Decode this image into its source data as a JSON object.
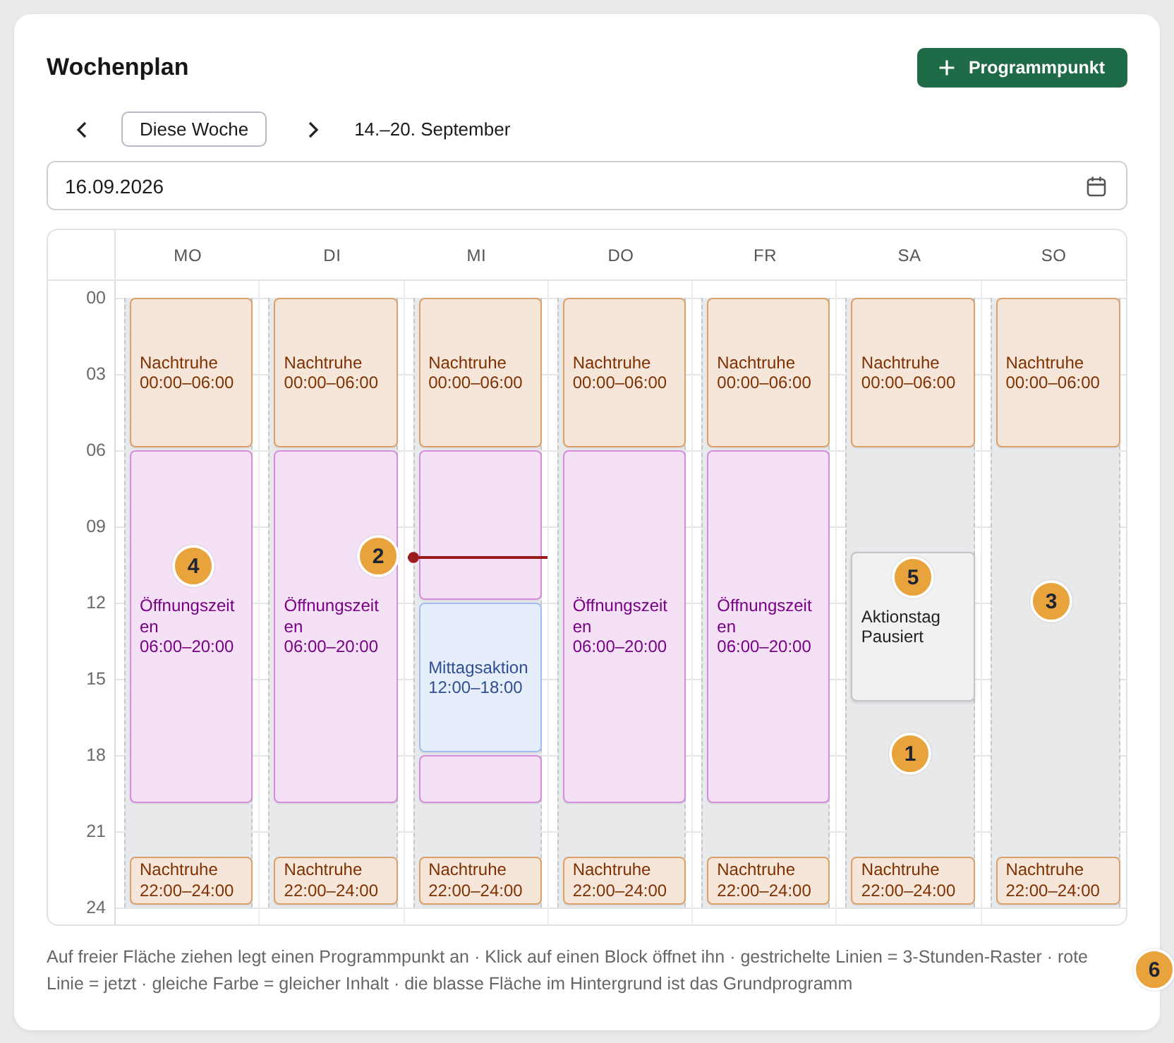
{
  "header": {
    "title": "Wochenplan",
    "add_button": "Programmpunkt"
  },
  "navigation": {
    "today_button": "Diese Woche",
    "range": "14.–20. September"
  },
  "date_field": {
    "value": "16.09.2026"
  },
  "calendar": {
    "hours": [
      "00",
      "03",
      "06",
      "09",
      "12",
      "15",
      "18",
      "21",
      "24"
    ],
    "days": [
      {
        "label": "MO",
        "today": false,
        "blocks": [
          {
            "title": "Nachtruhe",
            "detail": "00:00–06:00",
            "color": "#d9a06c",
            "paused": false
          },
          {
            "title": "Öffnungszeiten",
            "detail": "06:00–20:00",
            "color": "#d38ddb",
            "paused": false
          },
          {
            "title": "Nachtruhe",
            "detail": "22:00–24:00",
            "color": "#d9a06c",
            "paused": false
          }
        ]
      },
      {
        "label": "DI",
        "today": false,
        "blocks": [
          {
            "title": "Nachtruhe",
            "detail": "00:00–06:00",
            "color": "#d9a06c",
            "paused": false
          },
          {
            "title": "Öffnungszeiten",
            "detail": "06:00–20:00",
            "color": "#d38ddb",
            "paused": false
          },
          {
            "title": "Nachtruhe",
            "detail": "22:00–24:00",
            "color": "#d9a06c",
            "paused": false
          }
        ]
      },
      {
        "label": "MI",
        "today": true,
        "blocks": [
          {
            "title": "Nachtruhe",
            "detail": "00:00–06:00",
            "color": "#d9a06c",
            "paused": false
          },
          {
            "color": "#d38ddb",
            "paused": false
          },
          {
            "title": "Mittagsaktion",
            "detail": "12:00–18:00",
            "color": "#a2bcef",
            "paused": false
          },
          {
            "color": "#d38ddb",
            "paused": false
          },
          {
            "title": "Nachtruhe",
            "detail": "22:00–24:00",
            "color": "#d9a06c",
            "paused": false
          }
        ]
      },
      {
        "label": "DO",
        "today": false,
        "blocks": [
          {
            "title": "Nachtruhe",
            "detail": "00:00–06:00",
            "color": "#d9a06c",
            "paused": false
          },
          {
            "title": "Öffnungszeiten",
            "detail": "06:00–20:00",
            "color": "#d38ddb",
            "paused": false
          },
          {
            "title": "Nachtruhe",
            "detail": "22:00–24:00",
            "color": "#d9a06c",
            "paused": false
          }
        ]
      },
      {
        "label": "FR",
        "today": false,
        "blocks": [
          {
            "title": "Nachtruhe",
            "detail": "00:00–06:00",
            "color": "#d9a06c",
            "paused": false
          },
          {
            "title": "Öffnungszeiten",
            "detail": "06:00–20:00",
            "color": "#d38ddb",
            "paused": false
          },
          {
            "title": "Nachtruhe",
            "detail": "22:00–24:00",
            "color": "#d9a06c",
            "paused": false
          }
        ]
      },
      {
        "label": "SA",
        "today": false,
        "blocks": [
          {
            "title": "Nachtruhe",
            "detail": "00:00–06:00",
            "color": "#d9a06c",
            "paused": false
          },
          {
            "title": "Aktionstag",
            "detail": "Pausiert",
            "paused": true
          },
          {
            "title": "Nachtruhe",
            "detail": "22:00–24:00",
            "color": "#d9a06c",
            "paused": false
          }
        ]
      },
      {
        "label": "SO",
        "today": false,
        "blocks": [
          {
            "title": "Nachtruhe",
            "detail": "00:00–06:00",
            "color": "#d9a06c",
            "paused": false
          },
          {
            "title": "Nachtruhe",
            "detail": "22:00–24:00",
            "color": "#d9a06c",
            "paused": false
          }
        ]
      }
    ]
  },
  "hint": "Auf freier Fläche ziehen legt einen Programmpunkt an · Klick auf einen Block öffnet ihn · gestrichelte Linien = 3-Stunden-Raster · rote Linie = jetzt · gleiche Farbe = gleicher Inhalt · die blasse Fläche im Hintergrund ist das Grundprogramm",
  "markers": [
    "1",
    "2",
    "3",
    "4",
    "5",
    "6"
  ]
}
